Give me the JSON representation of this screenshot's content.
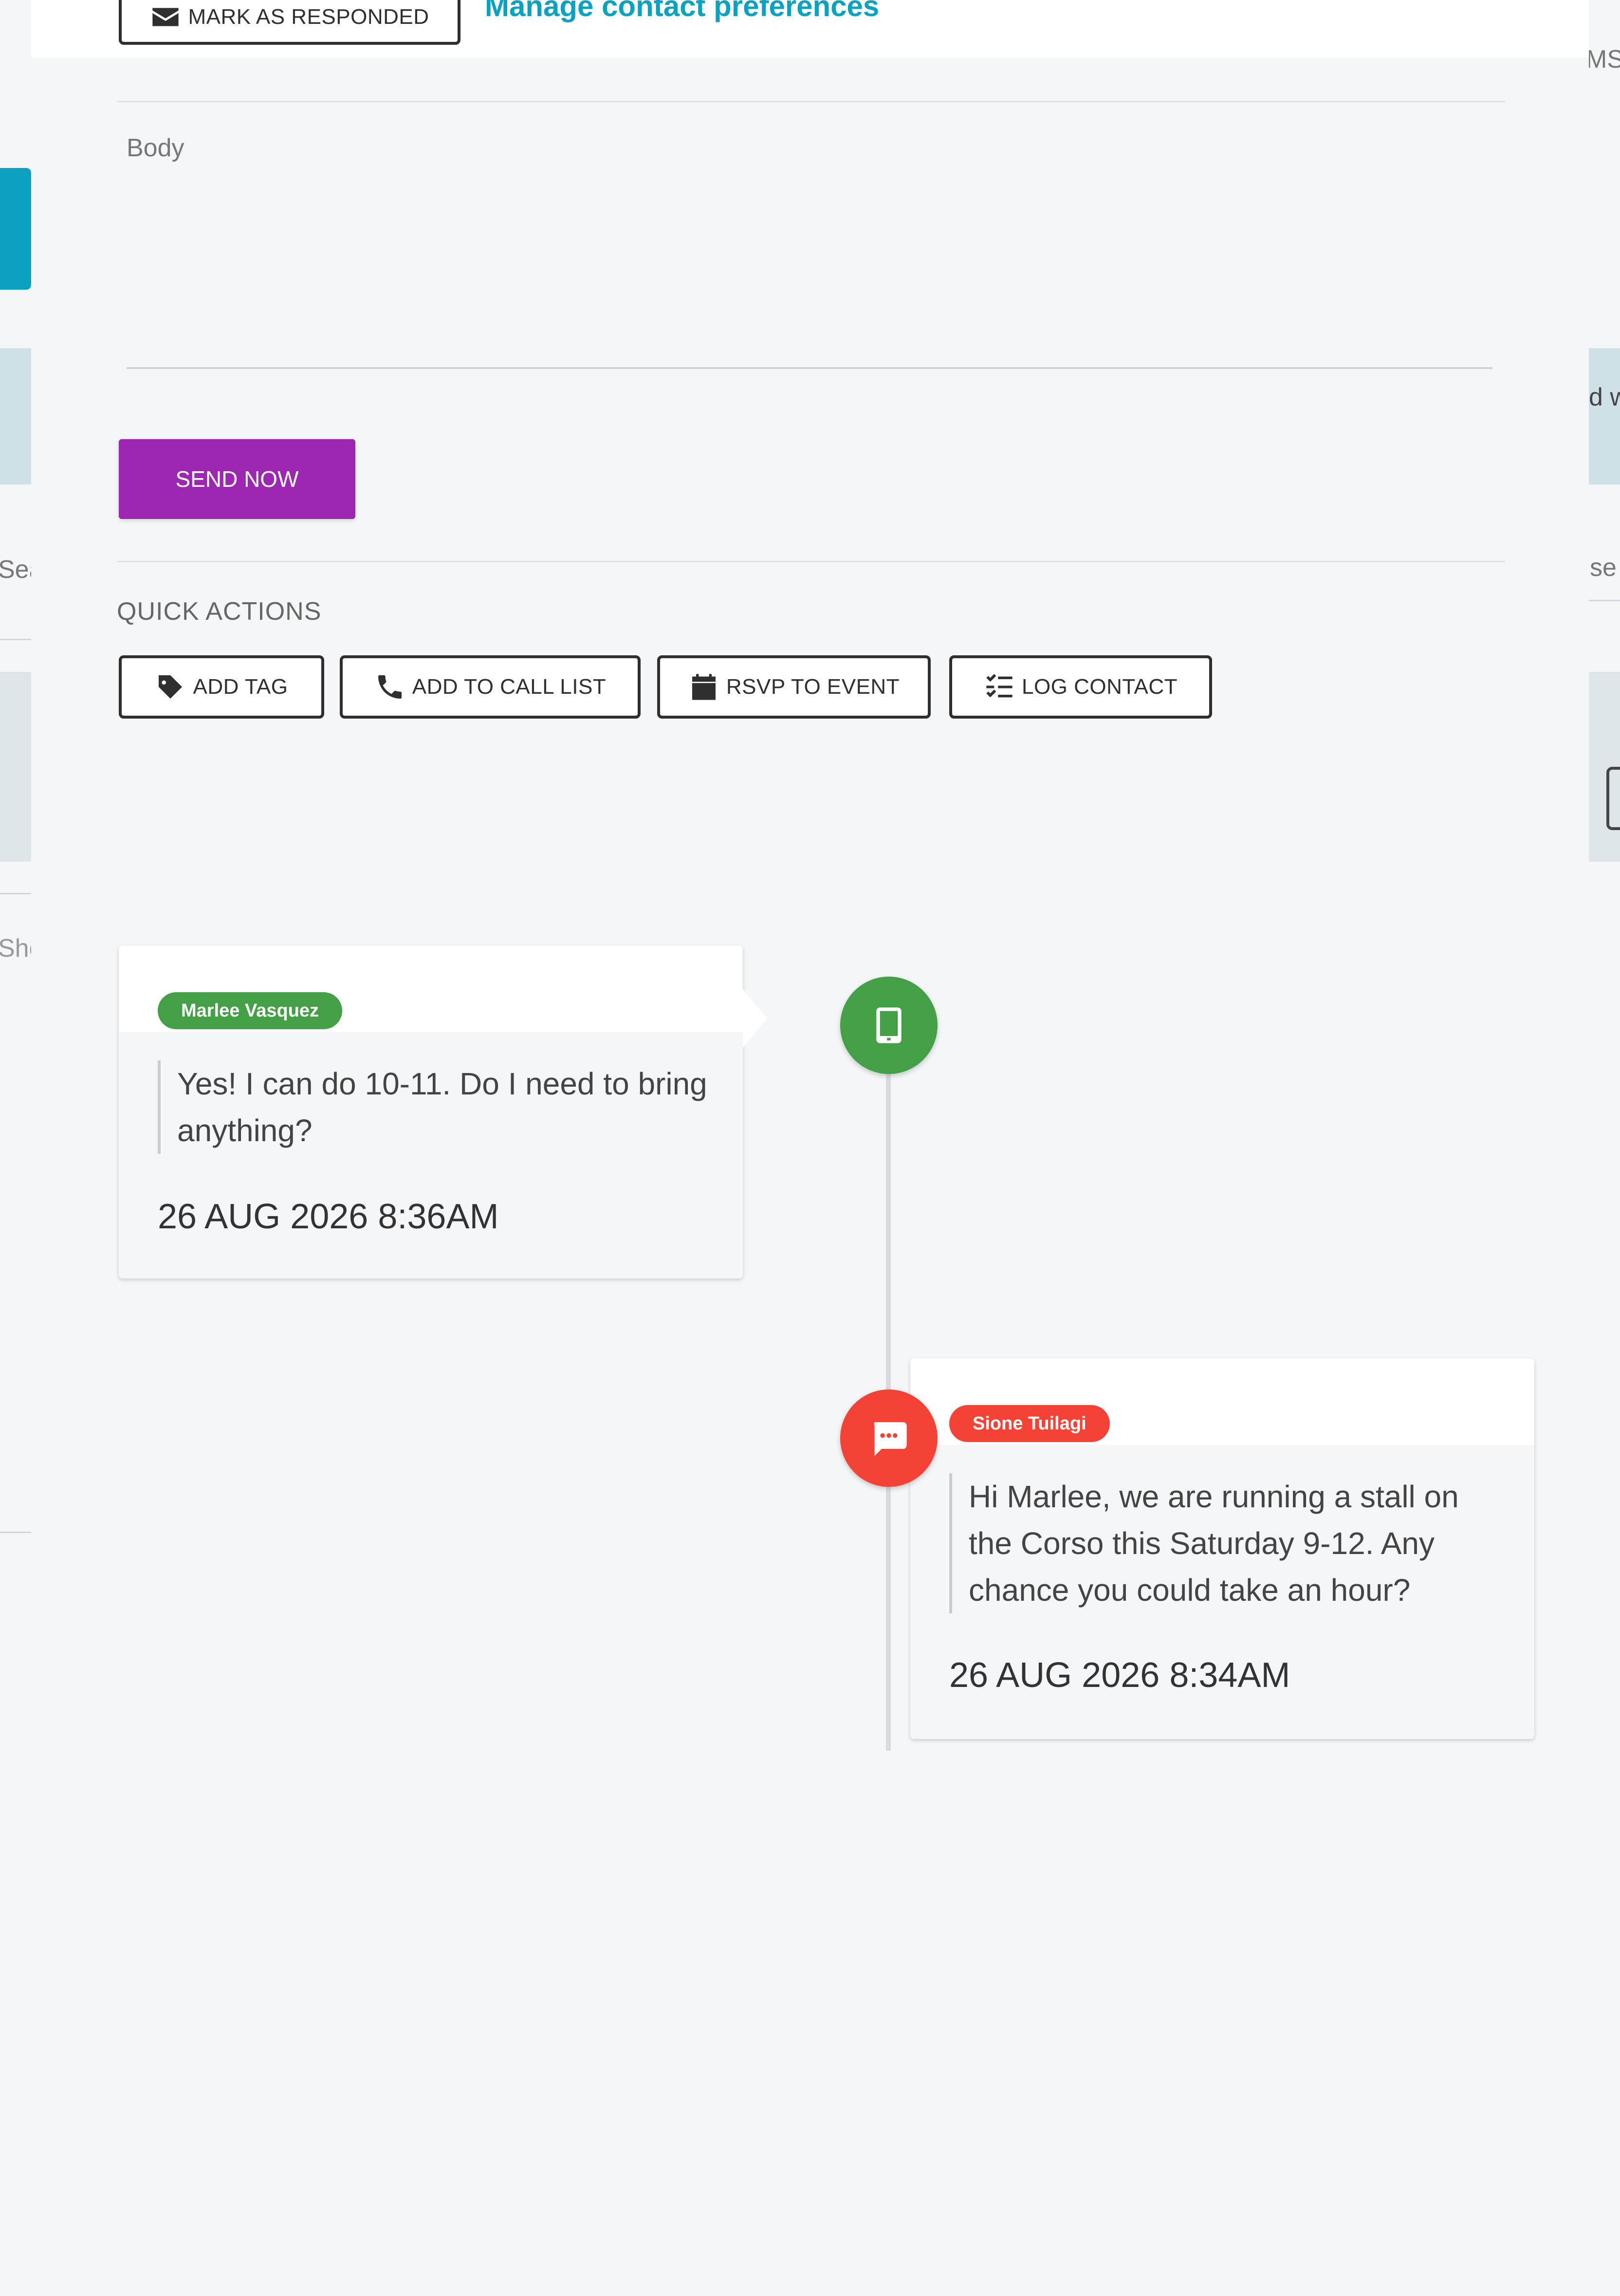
{
  "background": {
    "edge_texts": {
      "ms": "MS",
      "d_w": "d w",
      "sea": "Sea",
      "se": "se",
      "sho": "Sho"
    }
  },
  "header": {
    "mark_responded_label": "MARK AS RESPONDED",
    "manage_prefs_link": "Manage contact preferences"
  },
  "compose": {
    "body_label": "Body",
    "body_value": "",
    "send_label": "SEND NOW"
  },
  "quick_actions": {
    "title": "QUICK ACTIONS",
    "buttons": [
      {
        "label": "ADD TAG",
        "icon": "tag-icon"
      },
      {
        "label": "ADD TO CALL LIST",
        "icon": "phone-icon"
      },
      {
        "label": "RSVP TO EVENT",
        "icon": "calendar-icon"
      },
      {
        "label": "LOG CONTACT",
        "icon": "checklist-icon"
      }
    ]
  },
  "timeline": {
    "entries": [
      {
        "author": "Marlee Vasquez",
        "message": "Yes! I can do 10-11. Do I need to bring anything?",
        "timestamp": "26 AUG 2026 8:36AM",
        "icon": "mobile-phone-icon",
        "color": "#43a047",
        "side": "left"
      },
      {
        "author": "Sione Tuilagi",
        "message": "Hi Marlee, we are running a stall on the Corso this Saturday 9-12. Any chance you could take an hour?",
        "timestamp": "26 AUG 2026 8:34AM",
        "icon": "sms-chat-icon",
        "color": "#f44336",
        "side": "right"
      }
    ]
  },
  "colors": {
    "accent_teal": "#0aa2c0",
    "send_purple": "#9c27b0",
    "page_bg": "#f4f6f8"
  }
}
